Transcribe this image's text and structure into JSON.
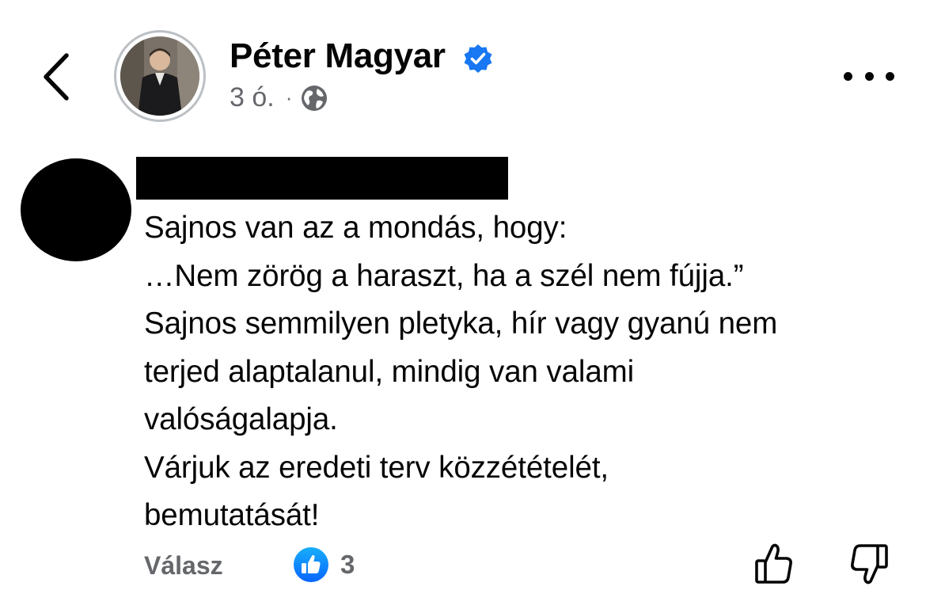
{
  "post": {
    "author_name": "Péter Magyar",
    "time": "3 ó.",
    "separator": "·",
    "verified": true,
    "accent_color": "#1877f2"
  },
  "icons": {
    "back": "chevron-left-icon",
    "verified": "verified-badge-icon",
    "audience": "globe-icon",
    "more": "more-options-icon",
    "like_reaction": "like-reaction-icon",
    "upvote": "thumbs-up-outline-icon",
    "downvote": "thumbs-down-outline-icon"
  },
  "comment": {
    "lines": [
      "Sajnos van az a mondás, hogy:",
      "…Nem zörög a haraszt, ha a szél nem fújja.”",
      "Sajnos semmilyen pletyka, hír vagy gyanú nem",
      "terjed alaptalanul, mindig van valami",
      "valóságalapja.",
      "Várjuk az eredeti terv közzétételét,",
      "bemutatását!"
    ],
    "reply_label": "Válasz",
    "reaction_count": "3"
  }
}
